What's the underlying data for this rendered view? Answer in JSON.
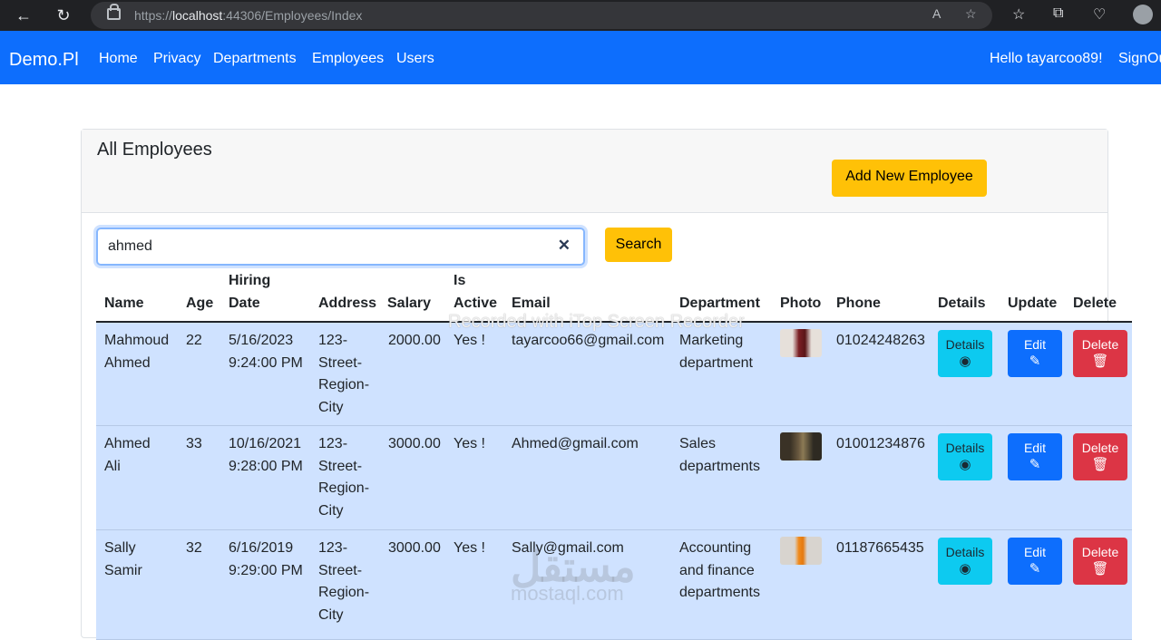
{
  "browser": {
    "url_prefix": "https://",
    "url_host": "localhost",
    "url_rest": ":44306/Employees/Index"
  },
  "navbar": {
    "brand": "Demo.Pl",
    "links": [
      "Home",
      "Privacy",
      "Departments",
      "Employees",
      "Users"
    ],
    "greeting": "Hello tayarcoo89!",
    "signout": "SignOut"
  },
  "card": {
    "title": "All Employees",
    "add_button": "Add New Employee"
  },
  "search": {
    "value": "ahmed",
    "button": "Search"
  },
  "table": {
    "headers": {
      "name": "Name",
      "age": "Age",
      "hiring1": "Hiring",
      "hiring2": "Date",
      "address": "Address",
      "salary": "Salary",
      "active1": "Is",
      "active2": "Active",
      "email": "Email",
      "department": "Department",
      "photo": "Photo",
      "phone": "Phone",
      "details": "Details",
      "update": "Update",
      "delete": "Delete"
    },
    "rows": [
      {
        "name1": "Mahmoud",
        "name2": "Ahmed",
        "age": "22",
        "date1": "5/16/2023",
        "date2": "9:24:00 PM",
        "addr1": "123-",
        "addr2": "Street-",
        "addr3": "Region-",
        "addr4": "City",
        "salary": "2000.00",
        "active": "Yes !",
        "email": "tayarcoo66@gmail.com",
        "dept1": "Marketing",
        "dept2": "department",
        "dept3": "",
        "phone": "01024248263"
      },
      {
        "name1": "Ahmed",
        "name2": "Ali",
        "age": "33",
        "date1": "10/16/2021",
        "date2": "9:28:00 PM",
        "addr1": "123-",
        "addr2": "Street-",
        "addr3": "Region-",
        "addr4": "City",
        "salary": "3000.00",
        "active": "Yes !",
        "email": "Ahmed@gmail.com",
        "dept1": "Sales",
        "dept2": "departments",
        "dept3": "",
        "phone": "01001234876"
      },
      {
        "name1": "Sally",
        "name2": "Samir",
        "age": "32",
        "date1": "6/16/2019",
        "date2": "9:29:00 PM",
        "addr1": "123-",
        "addr2": "Street-",
        "addr3": "Region-",
        "addr4": "City",
        "salary": "3000.00",
        "active": "Yes !",
        "email": "Sally@gmail.com",
        "dept1": "Accounting",
        "dept2": "and finance",
        "dept3": "departments",
        "phone": "01187665435"
      }
    ],
    "details_label": "Details",
    "edit_label": "Edit",
    "delete_label": "Delete"
  },
  "overlay": {
    "recorder_watermark": "Recorded with iTop Screen Recorder",
    "site_logo": "مستقل",
    "site_logo_text": "mostaql.com"
  },
  "colors": {
    "navbar": "#0d6efd",
    "warning": "#ffc107",
    "info": "#0dcaf0",
    "danger": "#dc3545",
    "row_bg": "#cfe2ff"
  }
}
